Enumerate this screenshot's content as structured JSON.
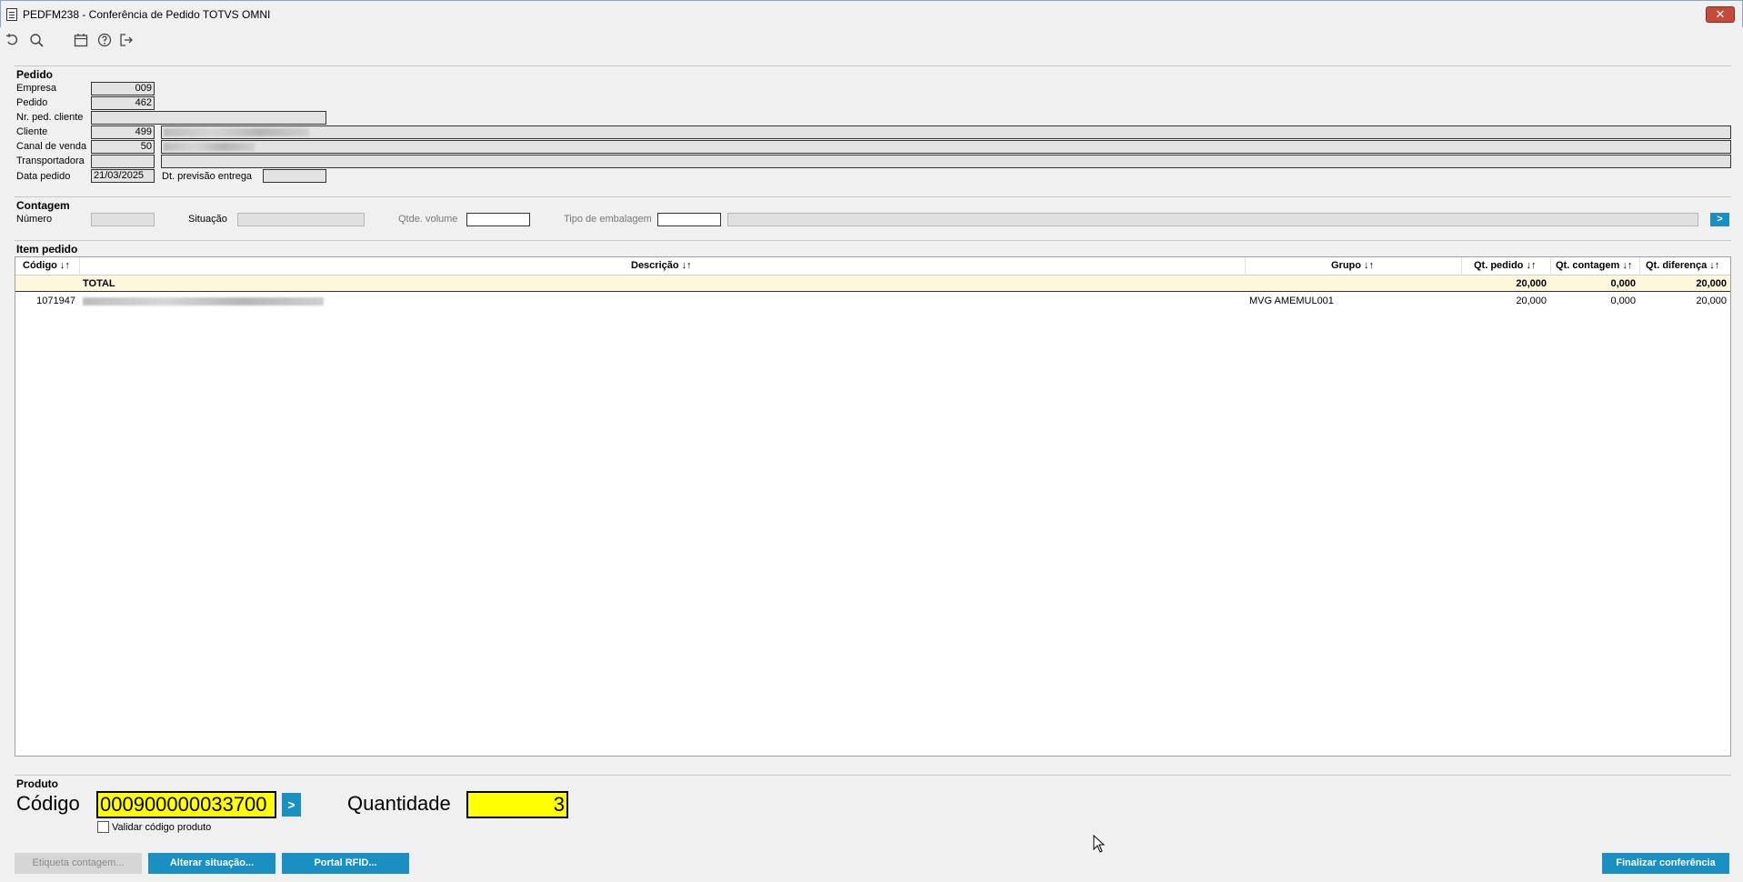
{
  "window": {
    "title": "PEDFM238 - Conferência de Pedido TOTVS OMNI",
    "close_label": "✕"
  },
  "toolbar": {
    "icons": [
      "undo-icon",
      "search-icon",
      "calendar-icon",
      "help-icon",
      "exit-icon"
    ]
  },
  "pedido": {
    "section_title": "Pedido",
    "empresa_label": "Empresa",
    "empresa_value": "009",
    "pedido_label": "Pedido",
    "pedido_value": "462",
    "nr_ped_cliente_label": "Nr. ped. cliente",
    "nr_ped_cliente_value": "",
    "cliente_label": "Cliente",
    "cliente_value": "499",
    "canal_label": "Canal de venda",
    "canal_value": "50",
    "transportadora_label": "Transportadora",
    "transportadora_value": "",
    "data_pedido_label": "Data pedido",
    "data_pedido_value": "21/03/2025",
    "dt_previsao_label": "Dt. previsão entrega",
    "dt_previsao_value": ""
  },
  "contagem": {
    "section_title": "Contagem",
    "numero_label": "Número",
    "numero_value": "",
    "situacao_label": "Situação",
    "situacao_value": "",
    "qtde_volume_label": "Qtde. volume",
    "qtde_volume_value": "",
    "tipo_embalagem_label": "Tipo de embalagem",
    "tipo_embalagem_value": "",
    "go_label": ">"
  },
  "item_pedido": {
    "section_title": "Item pedido",
    "columns": [
      "Código ↓↑",
      "Descrição ↓↑",
      "Grupo ↓↑",
      "Qt. pedido ↓↑",
      "Qt. contagem ↓↑",
      "Qt. diferença ↓↑"
    ],
    "total": {
      "label": "TOTAL",
      "qt_pedido": "20,000",
      "qt_contagem": "0,000",
      "qt_diferenca": "20,000"
    },
    "rows": [
      {
        "codigo": "1071947",
        "descricao": "",
        "grupo": "MVG AMEMUL001",
        "qt_pedido": "20,000",
        "qt_contagem": "0,000",
        "qt_diferenca": "20,000"
      }
    ]
  },
  "produto": {
    "section_title": "Produto",
    "codigo_label": "Código",
    "codigo_value": "000900000033700",
    "go_label": ">",
    "quantidade_label": "Quantidade",
    "quantidade_value": "3",
    "validar_label": "Validar código produto",
    "validar_checked": false
  },
  "buttons": {
    "etiqueta": "Etiqueta contagem...",
    "alterar": "Alterar situação...",
    "portal": "Portal RFID...",
    "finalizar": "Finalizar conferência"
  },
  "colors": {
    "accent": "#1a8fc1",
    "highlight": "#ffff00",
    "total_row": "#fdf8dc"
  }
}
